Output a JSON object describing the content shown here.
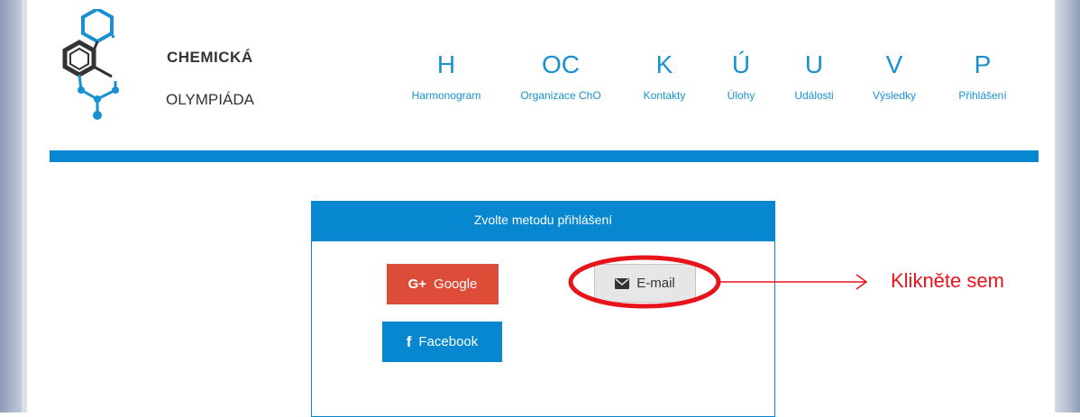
{
  "logo": {
    "line1": "CHEMICKÁ",
    "line2": "OLYMPIÁDA"
  },
  "nav": [
    {
      "letter": "H",
      "label": "Harmonogram"
    },
    {
      "letter": "OC",
      "label": "Organizace ChO"
    },
    {
      "letter": "K",
      "label": "Kontakty"
    },
    {
      "letter": "Ú",
      "label": "Úlohy"
    },
    {
      "letter": "U",
      "label": "Události"
    },
    {
      "letter": "V",
      "label": "Výsledky"
    },
    {
      "letter": "P",
      "label": "Přihlášení"
    }
  ],
  "login": {
    "title": "Zvolte metodu přihlášení",
    "google": {
      "icon_text": "G+",
      "label": "Google"
    },
    "email": {
      "icon": "envelope-icon",
      "label": "E-mail"
    },
    "facebook": {
      "icon_text": "f",
      "label": "Facebook"
    }
  },
  "annotation": {
    "text": "Klikněte sem"
  },
  "colors": {
    "accent": "#0787d0",
    "google": "#dd4b39",
    "annotation": "#e8141b"
  }
}
